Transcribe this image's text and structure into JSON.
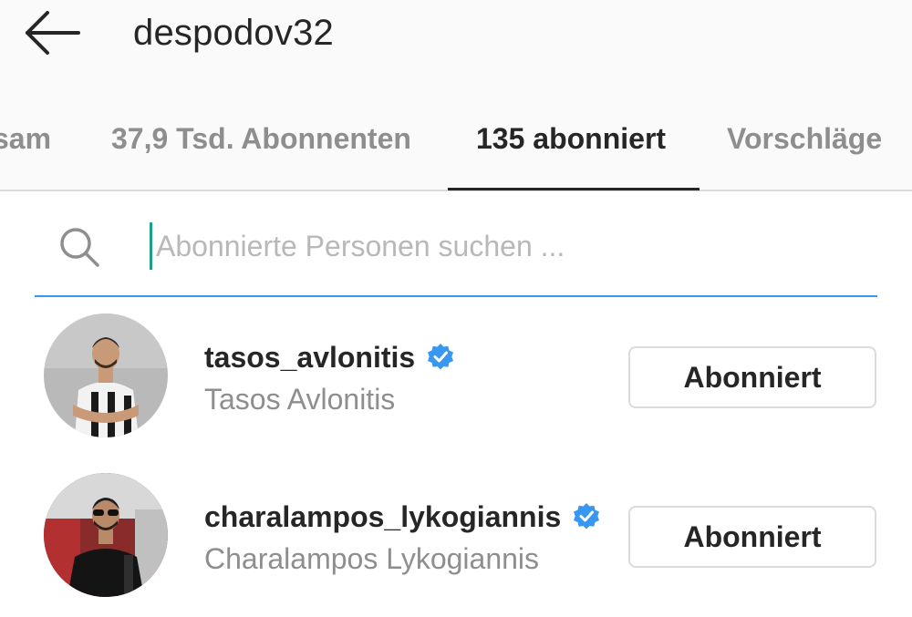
{
  "header": {
    "username": "despodov32",
    "back_icon": "arrow-left-icon"
  },
  "tabs": [
    {
      "label": "sam",
      "active": false
    },
    {
      "label": "37,9 Tsd. Abonnenten",
      "active": false
    },
    {
      "label": "135 abonniert",
      "active": true
    },
    {
      "label": "Vorschläge",
      "active": false
    }
  ],
  "search": {
    "placeholder": "Abonnierte Personen suchen ...",
    "value": "",
    "icon": "search-icon"
  },
  "users": [
    {
      "handle": "tasos_avlonitis",
      "full_name": "Tasos Avlonitis",
      "verified": true,
      "button_label": "Abonniert"
    },
    {
      "handle": "charalampos_lykogiannis",
      "full_name": "Charalampos Lykogiannis",
      "verified": true,
      "button_label": "Abonniert"
    }
  ],
  "colors": {
    "accent_blue": "#3897f0",
    "verified_blue": "#3897f0",
    "text_primary": "#262626",
    "text_secondary": "#8e8e8e",
    "caret": "#1fa08a"
  }
}
